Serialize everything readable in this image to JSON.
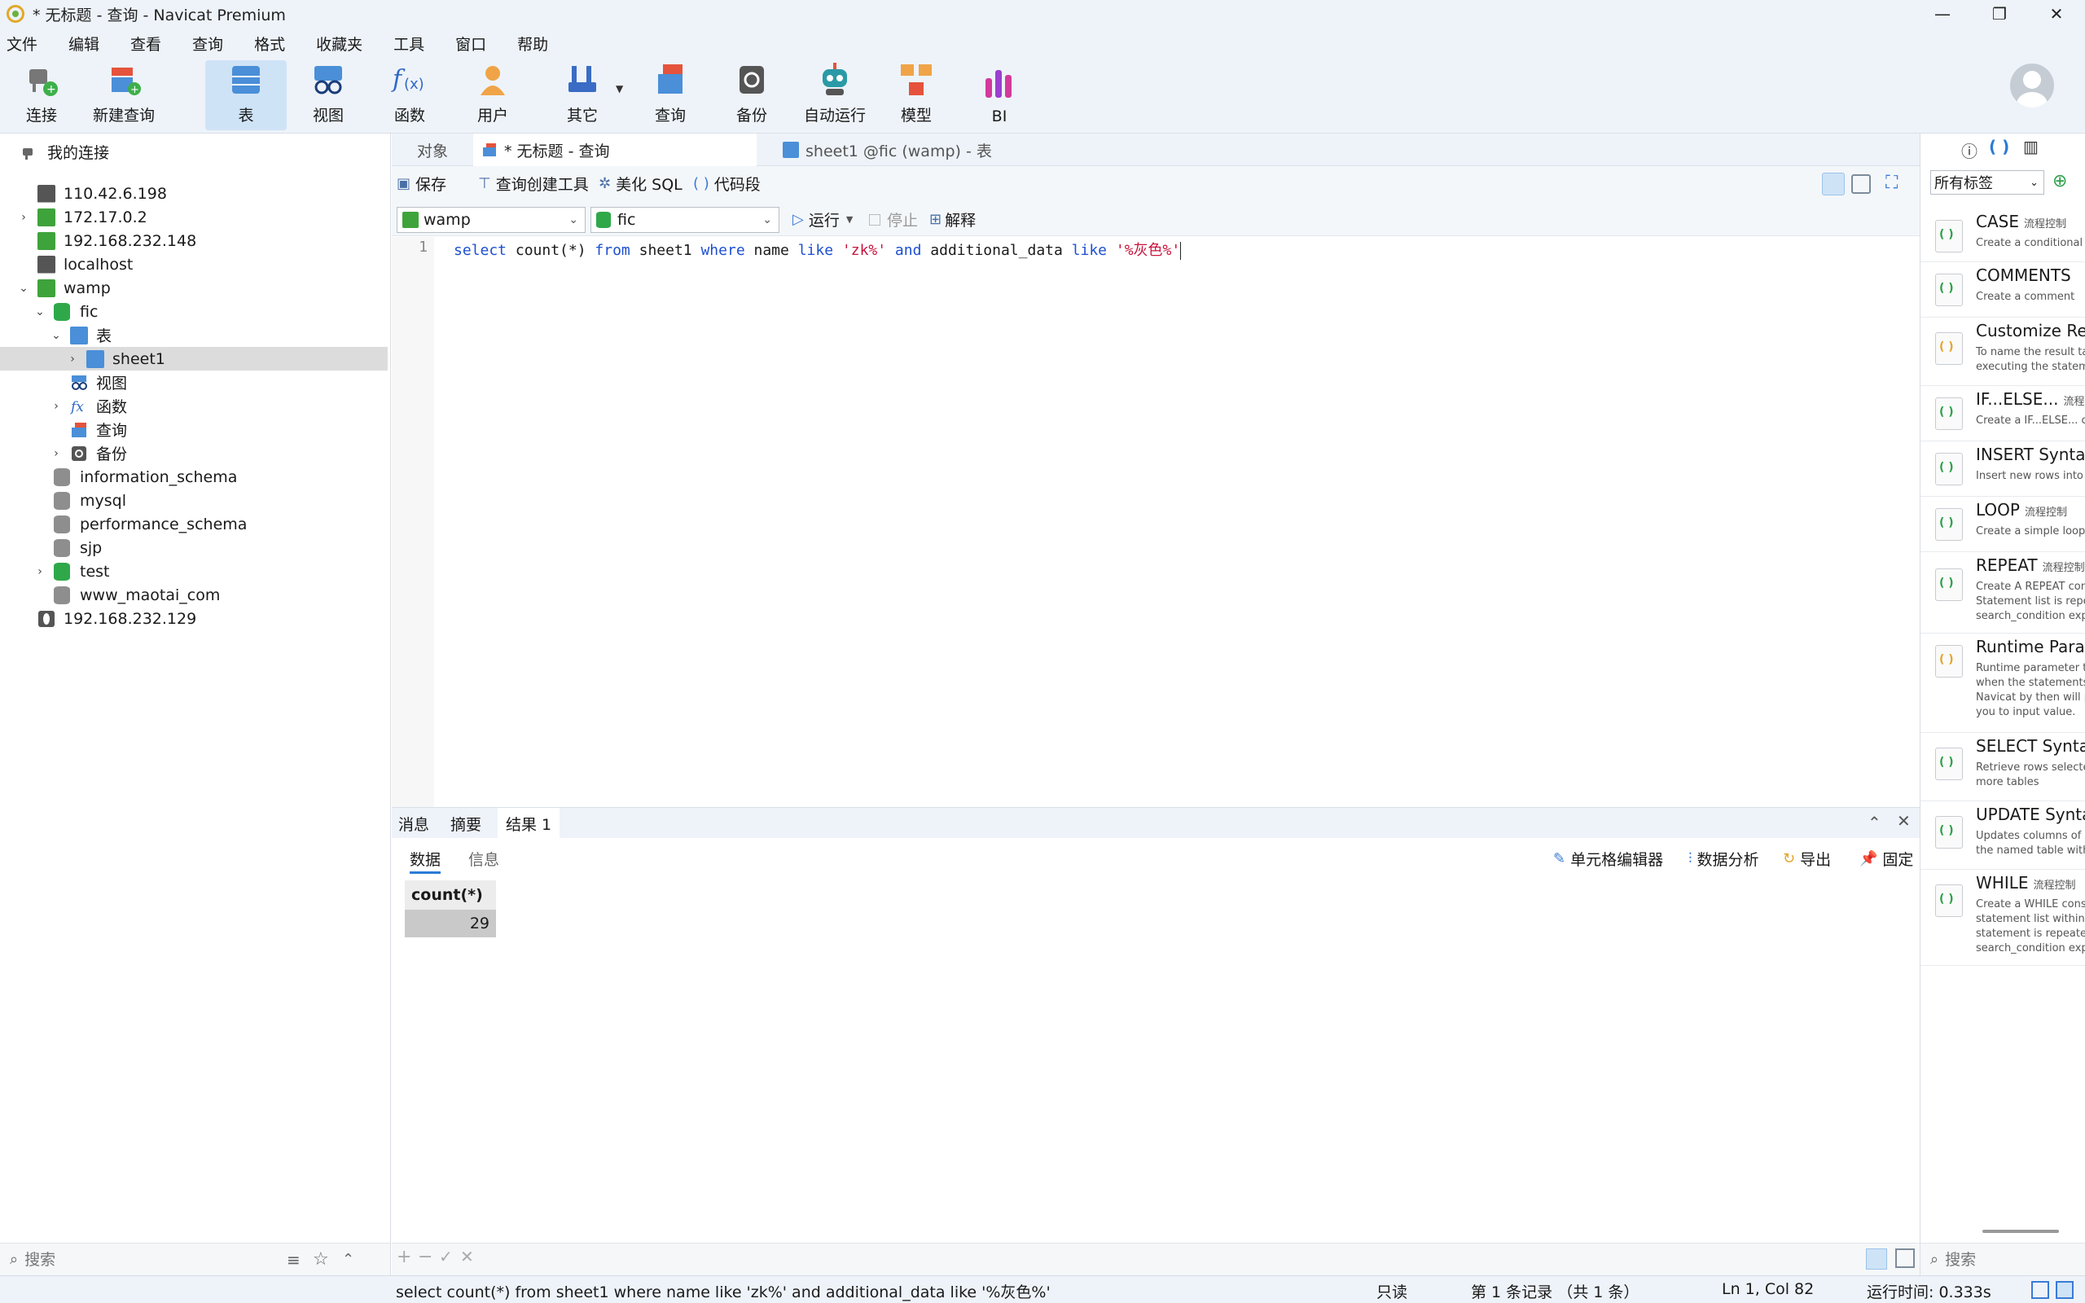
{
  "window": {
    "title": "* 无标题 - 查询 - Navicat Premium",
    "minimize": "—",
    "maximize": "❐",
    "close": "✕"
  },
  "menu": [
    "文件",
    "编辑",
    "查看",
    "查询",
    "格式",
    "收藏夹",
    "工具",
    "窗口",
    "帮助"
  ],
  "toolbar": {
    "connect": "连接",
    "new_query": "新建查询",
    "table": "表",
    "view": "视图",
    "function": "函数",
    "user": "用户",
    "other": "其它",
    "query": "查询",
    "backup": "备份",
    "automation": "自动运行",
    "model": "模型",
    "bi": "BI"
  },
  "sidebar": {
    "root": "我的连接",
    "items": [
      {
        "label": "110.42.6.198"
      },
      {
        "label": "172.17.0.2"
      },
      {
        "label": "192.168.232.148"
      },
      {
        "label": "localhost"
      },
      {
        "label": "wamp"
      },
      {
        "label": "fic"
      },
      {
        "label": "表"
      },
      {
        "label": "sheet1"
      },
      {
        "label": "视图"
      },
      {
        "label": "函数"
      },
      {
        "label": "查询"
      },
      {
        "label": "备份"
      },
      {
        "label": "information_schema"
      },
      {
        "label": "mysql"
      },
      {
        "label": "performance_schema"
      },
      {
        "label": "sjp"
      },
      {
        "label": "test"
      },
      {
        "label": "www_maotai_com"
      },
      {
        "label": "192.168.232.129"
      }
    ],
    "search_placeholder": "搜索"
  },
  "tabs": {
    "objects": "对象",
    "query_tab": "* 无标题 - 查询",
    "table_tab": "sheet1 @fic (wamp) - 表"
  },
  "editor_toolbar": {
    "save": "保存",
    "query_builder": "查询创建工具",
    "beautify": "美化 SQL",
    "snippet": "代码段",
    "connection": "wamp",
    "database": "fic",
    "run": "运行",
    "stop": "停止",
    "explain": "解释"
  },
  "editor": {
    "line_number": "1",
    "code": {
      "t1": "select",
      "t2": " count(*) ",
      "t3": "from",
      "t4": " sheet1 ",
      "t5": "where",
      "t6": " name ",
      "t7": "like",
      "t8": " ",
      "t9": "'zk%'",
      "t10": " ",
      "t11": "and",
      "t12": " additional_data ",
      "t13": "like",
      "t14": " ",
      "t15": "'%灰色%'"
    }
  },
  "results": {
    "tabs": [
      "消息",
      "摘要",
      "结果 1"
    ],
    "sub_tabs": [
      "数据",
      "信息"
    ],
    "actions": {
      "cell_editor": "单元格编辑器",
      "data_analysis": "数据分析",
      "export": "导出",
      "pin": "固定"
    },
    "column": "count(*)",
    "value": "29"
  },
  "right_panel": {
    "tag_filter": "所有标签",
    "search_placeholder": "搜索",
    "snippets": [
      {
        "title": "CASE",
        "tag": "流程控制",
        "desc": "Create a conditional c"
      },
      {
        "title": "COMMENTS",
        "tag": "",
        "desc": "Create a comment"
      },
      {
        "title": "Customize Res",
        "tag": "",
        "desc": "To name the result tab\nexecuting the stateme"
      },
      {
        "title": "IF...ELSE...",
        "tag": "流程控",
        "desc": "Create a IF...ELSE... co"
      },
      {
        "title": "INSERT Syntax",
        "tag": "",
        "desc": "Insert new rows into a"
      },
      {
        "title": "LOOP",
        "tag": "流程控制",
        "desc": "Create a simple loop c"
      },
      {
        "title": "REPEAT",
        "tag": "流程控制",
        "desc": "Create A REPEAT cons\nStatement list is repea\nsearch_condition expr"
      },
      {
        "title": "Runtime Param",
        "tag": "",
        "desc": "Runtime parameter to\nwhen the statements a\nNavicat by then will p\nyou to input value."
      },
      {
        "title": "SELECT Syntax",
        "tag": "",
        "desc": "Retrieve rows selected\nmore tables"
      },
      {
        "title": "UPDATE Synta",
        "tag": "",
        "desc": "Updates columns of e\nthe named table with"
      },
      {
        "title": "WHILE",
        "tag": "流程控制",
        "desc": "Create a WHILE const\nstatement list within a\nstatement is repeated\nsearch_condition expr"
      }
    ]
  },
  "statusbar": {
    "sql": "select count(*) from sheet1 where name like 'zk%' and additional_data like '%灰色%'",
    "readonly": "只读",
    "record": "第 1 条记录 （共 1 条）",
    "position": "Ln 1, Col 82",
    "runtime": "运行时间: 0.333s"
  }
}
